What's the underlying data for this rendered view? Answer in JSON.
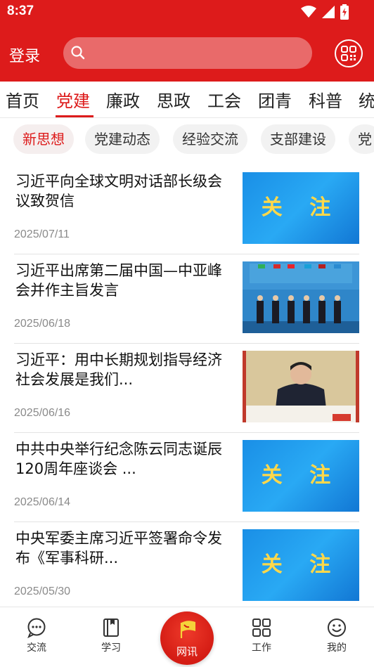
{
  "status_bar": {
    "time": "8:37"
  },
  "header": {
    "login_label": "登录",
    "search_placeholder": "",
    "qr_icon": "qr-code-icon",
    "color": "#dd1b1b"
  },
  "channels": [
    {
      "label": "首页"
    },
    {
      "label": "党建",
      "active": true
    },
    {
      "label": "廉政"
    },
    {
      "label": "思政"
    },
    {
      "label": "工会"
    },
    {
      "label": "团青"
    },
    {
      "label": "科普"
    },
    {
      "label": "统"
    }
  ],
  "subtabs": [
    {
      "label": "新思想",
      "active": true
    },
    {
      "label": "党建动态"
    },
    {
      "label": "经验交流"
    },
    {
      "label": "支部建设"
    },
    {
      "label": "党"
    }
  ],
  "news": [
    {
      "title": "习近平向全球文明对话部长级会议致贺信",
      "date": "2025/07/11",
      "thumb": "关 注"
    },
    {
      "title": "习近平出席第二届中国—中亚峰会并作主旨发言",
      "date": "2025/06/18",
      "thumb": "photo-summit"
    },
    {
      "title": "习近平：用中长期规划指导经济社会发展是我们...",
      "date": "2025/06/16",
      "thumb": "photo-speech"
    },
    {
      "title": "中共中央举行纪念陈云同志诞辰120周年座谈会 ...",
      "date": "2025/06/14",
      "thumb": "关 注"
    },
    {
      "title": "中央军委主席习近平签署命令发布《军事科研...",
      "date": "2025/05/30",
      "thumb": "关 注"
    }
  ],
  "bottom_nav": {
    "items": [
      {
        "label": "交流",
        "icon": "chat-icon"
      },
      {
        "label": "学习",
        "icon": "book-icon"
      },
      {
        "label": "网讯",
        "icon": "party-emblem-icon",
        "active": true
      },
      {
        "label": "工作",
        "icon": "grid-icon"
      },
      {
        "label": "我的",
        "icon": "smiley-icon"
      }
    ]
  }
}
